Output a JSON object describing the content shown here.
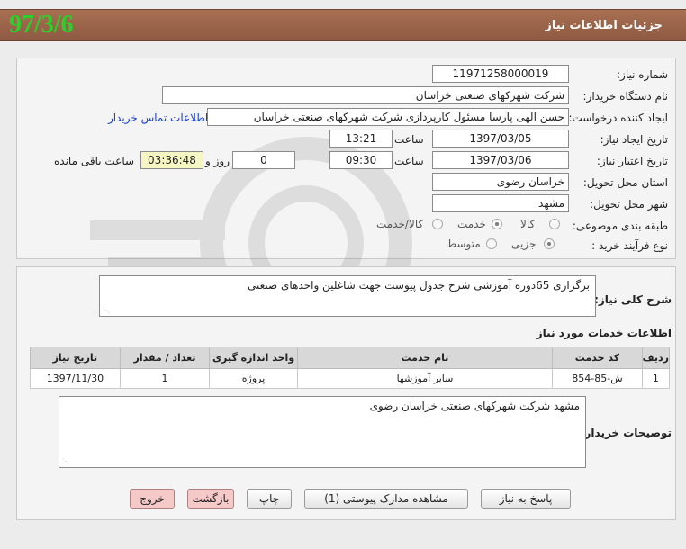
{
  "header": {
    "title": "جزئیات اطلاعات نیاز",
    "date_stamp": "97/3/6"
  },
  "form": {
    "need_number_label": "شماره نیاز:",
    "need_number": "11971258000019",
    "buyer_org_label": "نام دستگاه خریدار:",
    "buyer_org": "شرکت شهرکهای صنعتی خراسان",
    "requester_label": "ایجاد کننده درخواست:",
    "requester": "حسن الهی پارسا مسئول کارپردازی شرکت شهرکهای صنعتی خراسان",
    "contact_link": "اطلاعات تماس خریدار",
    "created_label": "تاریخ ایجاد نیاز:",
    "created_date": "1397/03/05",
    "time_label": "ساعت",
    "created_time": "13:21",
    "validity_label": "تاریخ اعتبار نیاز:",
    "validity_date": "1397/03/06",
    "validity_time": "09:30",
    "days_value": "0",
    "days_label": "روز و",
    "remaining_time": "03:36:48",
    "remaining_label": "ساعت باقی مانده",
    "province_label": "استان محل تحویل:",
    "province": "خراسان رضوی",
    "city_label": "شهر محل تحویل:",
    "city": "مشهد",
    "category_label": "طبقه بندی موضوعی:",
    "category_options": [
      "کالا",
      "خدمت",
      "کالا/خدمت"
    ],
    "category_selected": "خدمت",
    "process_label": "نوع فرآیند خرید :",
    "process_options": [
      "جزیی",
      "متوسط"
    ],
    "process_selected": "جزیی"
  },
  "summary": {
    "label": "شرح کلی نیاز:",
    "text": "برگزاری 65دوره آموزشی شرح جدول پیوست جهت شاغلین واحدهای صنعتی"
  },
  "services": {
    "title": "اطلاعات خدمات مورد نیاز",
    "columns": [
      "ردیف",
      "کد خدمت",
      "نام خدمت",
      "واحد اندازه گیری",
      "تعداد / مقدار",
      "تاریخ نیاز"
    ],
    "rows": [
      [
        "1",
        "ش-85-854",
        "سایر آموزشها",
        "پروژه",
        "1",
        "1397/11/30"
      ]
    ]
  },
  "buyer_notes": {
    "label": "توضیحات خریدار:",
    "text": "مشهد شرکت شهرکهای صنعتی خراسان رضوی"
  },
  "buttons": {
    "reply": "پاسخ به نیاز",
    "attachments": "مشاهده مدارک پیوستی (1)",
    "print": "چاپ",
    "back": "بازگشت",
    "exit": "خروج"
  }
}
